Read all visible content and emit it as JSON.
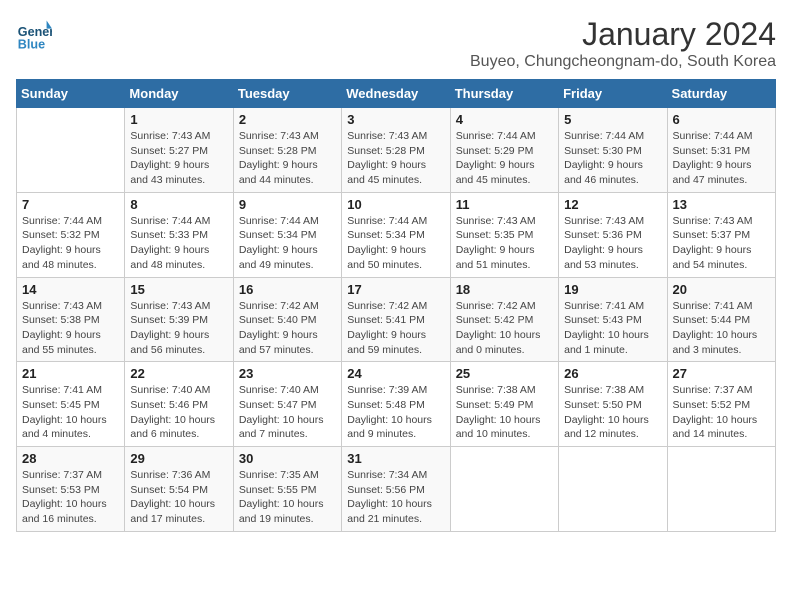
{
  "header": {
    "logo_line1": "General",
    "logo_line2": "Blue",
    "title": "January 2024",
    "subtitle": "Buyeo, Chungcheongnam-do, South Korea"
  },
  "days_of_week": [
    "Sunday",
    "Monday",
    "Tuesday",
    "Wednesday",
    "Thursday",
    "Friday",
    "Saturday"
  ],
  "weeks": [
    [
      {
        "day": "",
        "info": ""
      },
      {
        "day": "1",
        "info": "Sunrise: 7:43 AM\nSunset: 5:27 PM\nDaylight: 9 hours\nand 43 minutes."
      },
      {
        "day": "2",
        "info": "Sunrise: 7:43 AM\nSunset: 5:28 PM\nDaylight: 9 hours\nand 44 minutes."
      },
      {
        "day": "3",
        "info": "Sunrise: 7:43 AM\nSunset: 5:28 PM\nDaylight: 9 hours\nand 45 minutes."
      },
      {
        "day": "4",
        "info": "Sunrise: 7:44 AM\nSunset: 5:29 PM\nDaylight: 9 hours\nand 45 minutes."
      },
      {
        "day": "5",
        "info": "Sunrise: 7:44 AM\nSunset: 5:30 PM\nDaylight: 9 hours\nand 46 minutes."
      },
      {
        "day": "6",
        "info": "Sunrise: 7:44 AM\nSunset: 5:31 PM\nDaylight: 9 hours\nand 47 minutes."
      }
    ],
    [
      {
        "day": "7",
        "info": "Sunrise: 7:44 AM\nSunset: 5:32 PM\nDaylight: 9 hours\nand 48 minutes."
      },
      {
        "day": "8",
        "info": "Sunrise: 7:44 AM\nSunset: 5:33 PM\nDaylight: 9 hours\nand 48 minutes."
      },
      {
        "day": "9",
        "info": "Sunrise: 7:44 AM\nSunset: 5:34 PM\nDaylight: 9 hours\nand 49 minutes."
      },
      {
        "day": "10",
        "info": "Sunrise: 7:44 AM\nSunset: 5:34 PM\nDaylight: 9 hours\nand 50 minutes."
      },
      {
        "day": "11",
        "info": "Sunrise: 7:43 AM\nSunset: 5:35 PM\nDaylight: 9 hours\nand 51 minutes."
      },
      {
        "day": "12",
        "info": "Sunrise: 7:43 AM\nSunset: 5:36 PM\nDaylight: 9 hours\nand 53 minutes."
      },
      {
        "day": "13",
        "info": "Sunrise: 7:43 AM\nSunset: 5:37 PM\nDaylight: 9 hours\nand 54 minutes."
      }
    ],
    [
      {
        "day": "14",
        "info": "Sunrise: 7:43 AM\nSunset: 5:38 PM\nDaylight: 9 hours\nand 55 minutes."
      },
      {
        "day": "15",
        "info": "Sunrise: 7:43 AM\nSunset: 5:39 PM\nDaylight: 9 hours\nand 56 minutes."
      },
      {
        "day": "16",
        "info": "Sunrise: 7:42 AM\nSunset: 5:40 PM\nDaylight: 9 hours\nand 57 minutes."
      },
      {
        "day": "17",
        "info": "Sunrise: 7:42 AM\nSunset: 5:41 PM\nDaylight: 9 hours\nand 59 minutes."
      },
      {
        "day": "18",
        "info": "Sunrise: 7:42 AM\nSunset: 5:42 PM\nDaylight: 10 hours\nand 0 minutes."
      },
      {
        "day": "19",
        "info": "Sunrise: 7:41 AM\nSunset: 5:43 PM\nDaylight: 10 hours\nand 1 minute."
      },
      {
        "day": "20",
        "info": "Sunrise: 7:41 AM\nSunset: 5:44 PM\nDaylight: 10 hours\nand 3 minutes."
      }
    ],
    [
      {
        "day": "21",
        "info": "Sunrise: 7:41 AM\nSunset: 5:45 PM\nDaylight: 10 hours\nand 4 minutes."
      },
      {
        "day": "22",
        "info": "Sunrise: 7:40 AM\nSunset: 5:46 PM\nDaylight: 10 hours\nand 6 minutes."
      },
      {
        "day": "23",
        "info": "Sunrise: 7:40 AM\nSunset: 5:47 PM\nDaylight: 10 hours\nand 7 minutes."
      },
      {
        "day": "24",
        "info": "Sunrise: 7:39 AM\nSunset: 5:48 PM\nDaylight: 10 hours\nand 9 minutes."
      },
      {
        "day": "25",
        "info": "Sunrise: 7:38 AM\nSunset: 5:49 PM\nDaylight: 10 hours\nand 10 minutes."
      },
      {
        "day": "26",
        "info": "Sunrise: 7:38 AM\nSunset: 5:50 PM\nDaylight: 10 hours\nand 12 minutes."
      },
      {
        "day": "27",
        "info": "Sunrise: 7:37 AM\nSunset: 5:52 PM\nDaylight: 10 hours\nand 14 minutes."
      }
    ],
    [
      {
        "day": "28",
        "info": "Sunrise: 7:37 AM\nSunset: 5:53 PM\nDaylight: 10 hours\nand 16 minutes."
      },
      {
        "day": "29",
        "info": "Sunrise: 7:36 AM\nSunset: 5:54 PM\nDaylight: 10 hours\nand 17 minutes."
      },
      {
        "day": "30",
        "info": "Sunrise: 7:35 AM\nSunset: 5:55 PM\nDaylight: 10 hours\nand 19 minutes."
      },
      {
        "day": "31",
        "info": "Sunrise: 7:34 AM\nSunset: 5:56 PM\nDaylight: 10 hours\nand 21 minutes."
      },
      {
        "day": "",
        "info": ""
      },
      {
        "day": "",
        "info": ""
      },
      {
        "day": "",
        "info": ""
      }
    ]
  ]
}
